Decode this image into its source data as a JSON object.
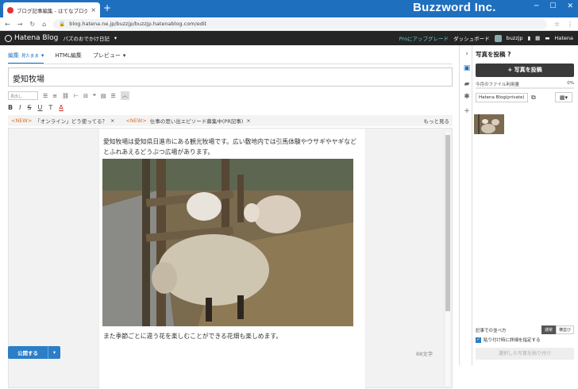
{
  "browser": {
    "tab_title": "ブログ記事編集 - はてなブログ",
    "close_glyph": "×",
    "new_tab_glyph": "+",
    "url": "blog.hatena.ne.jp/buzzjp/buzzjp.hatenablog.com/edit",
    "brand_overlay": "Buzzword Inc.",
    "window_controls": [
      "─",
      "☐",
      "✕"
    ],
    "nav_glyphs": {
      "back": "←",
      "forward": "→",
      "reload": "↻",
      "home": "⌂",
      "lock": "🔒",
      "star": "☆",
      "menu": "⋮"
    }
  },
  "hatena_nav": {
    "logo": "Hatena Blog",
    "blog_name": "パズのおでかけ日記",
    "blog_name_caret": "▾",
    "pro_link": "Proにアップグレード",
    "dashboard": "ダッシュボード",
    "user": "buzzjp",
    "right_logo": "Hatena"
  },
  "editor": {
    "tabs": [
      {
        "label": "編集",
        "sub": "見たまま",
        "caret": "▾"
      },
      {
        "label": "HTML編集",
        "sub": "",
        "caret": ""
      },
      {
        "label": "プレビュー",
        "sub": "",
        "caret": "▾"
      }
    ],
    "title": "愛知牧場",
    "heading_select": "見出し",
    "toolbar2": [
      "B",
      "I",
      "S",
      "U",
      "T",
      "A"
    ],
    "suggestions": [
      {
        "tag": "<NEW>",
        "text": "「オンライン」どう使ってる？",
        "close": "×"
      },
      {
        "tag": "<NEW>",
        "text": "仕事の思い出エピソード募集中(PR記事)",
        "close": "×"
      }
    ],
    "more": "もっと見る",
    "body_para1": "愛知牧場は愛知県日進市にある観光牧場です。広い敷地内では引馬体験やウサギやヤギなどとふれあえるどうぶつ広場があります。",
    "body_para2": "また季節ごとに違う花を楽しむことができる花畑も楽しめます。",
    "photo_alt": "羊の写真",
    "publish": "公開する",
    "publish_caret": "▾",
    "char_count": "88文字"
  },
  "sidebar": {
    "heading": "写真を投稿",
    "help": "?",
    "post_button": "写真を投稿",
    "usage_label": "今月のファイル利用量",
    "usage_value": "0%",
    "usage_fraction": 0.0,
    "album": "Hatena Blog(private)",
    "grid_icon": "▦▾",
    "sort_label": "記事での並べ方",
    "sort_options": [
      "通常",
      "横並び"
    ],
    "sort_selected": 0,
    "detail_check": "貼り付け時に詳細を指定する",
    "paste_button": "選択した写真を貼り付け"
  },
  "colors": {
    "accent": "#1f6fbf",
    "nav_bg": "#252525",
    "new_tag": "#e07020"
  }
}
